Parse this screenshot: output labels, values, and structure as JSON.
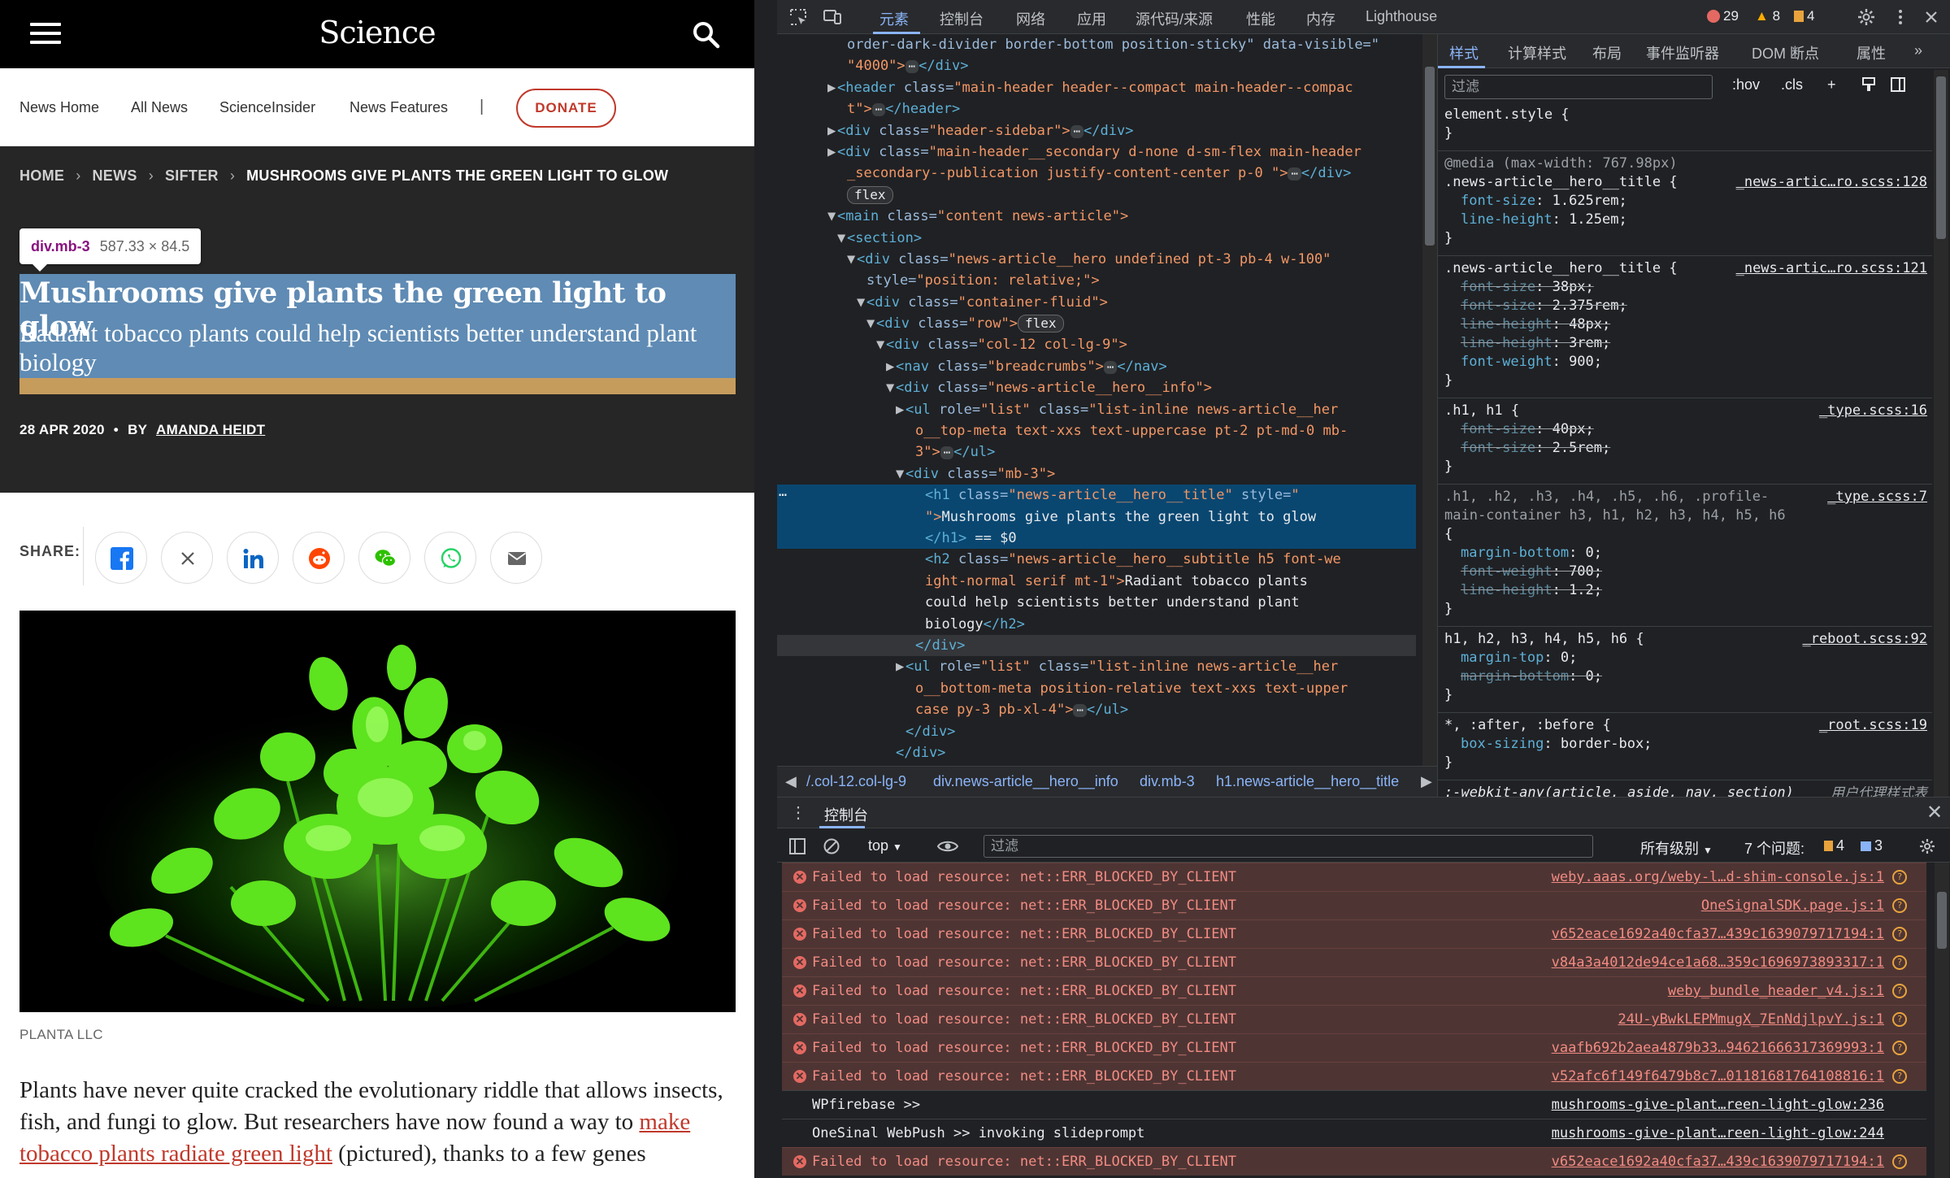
{
  "site": {
    "logo": "Science",
    "subnav": [
      "News Home",
      "All News",
      "ScienceInsider",
      "News Features"
    ],
    "subnav_sep": "|",
    "donate": "DONATE",
    "breadcrumb": [
      "HOME",
      "NEWS",
      "SIFTER",
      "MUSHROOMS GIVE PLANTS THE GREEN LIGHT TO GLOW"
    ],
    "tooltip": {
      "tag": "div.mb-3",
      "dims": "587.33 × 84.5"
    },
    "title": "Mushrooms give plants the green light to glow",
    "subtitle": "Radiant tobacco plants could help scientists better understand plant biology",
    "date": "28 APR 2020",
    "dot": "•",
    "by": "BY",
    "author": "AMANDA HEIDT",
    "share_label": "SHARE:",
    "share_icons": [
      "facebook-icon",
      "x-icon",
      "linkedin-icon",
      "reddit-icon",
      "wechat-icon",
      "whatsapp-icon",
      "email-icon"
    ],
    "photo_credit": "PLANTA LLC",
    "body_pre": "Plants have never quite cracked the evolutionary riddle that allows insects, fish, and fungi to glow. But researchers have now found a way to ",
    "body_link": "make tobacco plants radiate green light",
    "body_post": " (pictured), thanks to a few genes",
    "colors": {
      "accent": "#c0392b",
      "hero_bg": "#262626",
      "highlight": "#6fa8dc",
      "margin_hl": "#c69c5d"
    }
  },
  "devtools": {
    "tabs": [
      "元素",
      "控制台",
      "网络",
      "应用",
      "源代码/来源",
      "性能",
      "内存",
      "Lighthouse"
    ],
    "active_tab": "元素",
    "counts": {
      "errors": "29",
      "warnings": "8",
      "issues": "4"
    },
    "dom": [
      {
        "tri": "",
        "t": [
          [
            "at",
            "order-dark-divider border-bottom position-sticky\" data-visible=\""
          ]
        ],
        "indent": 6
      },
      {
        "tri": "",
        "t": [
          [
            "av",
            "\"4000\">"
          ],
          [
            "ell",
            "⋯"
          ],
          [
            "tag",
            "</div>"
          ]
        ],
        "indent": 6
      },
      {
        "tri": "▶",
        "t": [
          [
            "tag",
            "<header "
          ],
          [
            "at",
            "class="
          ],
          [
            "av",
            "\"main-header header--compact main-header--compac"
          ]
        ],
        "indent": 5
      },
      {
        "tri": "",
        "t": [
          [
            "av",
            "t\">"
          ],
          [
            "ell",
            "⋯"
          ],
          [
            "tag",
            "</header>"
          ]
        ],
        "indent": 6
      },
      {
        "tri": "▶",
        "t": [
          [
            "tag",
            "<div "
          ],
          [
            "at",
            "class="
          ],
          [
            "av",
            "\"header-sidebar\">"
          ],
          [
            "ell",
            "⋯"
          ],
          [
            "tag",
            "</div>"
          ]
        ],
        "indent": 5
      },
      {
        "tri": "▶",
        "t": [
          [
            "tag",
            "<div "
          ],
          [
            "at",
            "class="
          ],
          [
            "av",
            "\"main-header__secondary d-none d-sm-flex main-header"
          ]
        ],
        "indent": 5
      },
      {
        "tri": "",
        "t": [
          [
            "av",
            "_secondary--publication justify-content-center p-0 \">"
          ],
          [
            "ell",
            "⋯"
          ],
          [
            "tag",
            "</div>"
          ]
        ],
        "indent": 6
      },
      {
        "tri": "",
        "t": [
          [
            "pill",
            "flex"
          ]
        ],
        "indent": 6
      },
      {
        "tri": "▼",
        "t": [
          [
            "tag",
            "<main "
          ],
          [
            "at",
            "class="
          ],
          [
            "av",
            "\"content news-article\">"
          ]
        ],
        "indent": 5
      },
      {
        "tri": "▼",
        "t": [
          [
            "tag",
            "<section>"
          ]
        ],
        "indent": 6
      },
      {
        "tri": "▼",
        "t": [
          [
            "tag",
            "<div "
          ],
          [
            "at",
            "class="
          ],
          [
            "av",
            "\"news-article__hero undefined pt-3 pb-4 w-100\""
          ]
        ],
        "indent": 7
      },
      {
        "tri": "",
        "t": [
          [
            "at",
            "style="
          ],
          [
            "av",
            "\"position: relative;\">"
          ]
        ],
        "indent": 8
      },
      {
        "tri": "▼",
        "t": [
          [
            "tag",
            "<div "
          ],
          [
            "at",
            "class="
          ],
          [
            "av",
            "\"container-fluid\">"
          ]
        ],
        "indent": 8
      },
      {
        "tri": "▼",
        "t": [
          [
            "tag",
            "<div "
          ],
          [
            "at",
            "class="
          ],
          [
            "av",
            "\"row\">"
          ],
          [
            "pill",
            "flex"
          ]
        ],
        "indent": 9
      },
      {
        "tri": "▼",
        "t": [
          [
            "tag",
            "<div "
          ],
          [
            "at",
            "class="
          ],
          [
            "av",
            "\"col-12 col-lg-9\">"
          ]
        ],
        "indent": 10
      },
      {
        "tri": "▶",
        "t": [
          [
            "tag",
            "<nav "
          ],
          [
            "at",
            "class="
          ],
          [
            "av",
            "\"breadcrumbs\">"
          ],
          [
            "ell",
            "⋯"
          ],
          [
            "tag",
            "</nav>"
          ]
        ],
        "indent": 11
      },
      {
        "tri": "▼",
        "t": [
          [
            "tag",
            "<div "
          ],
          [
            "at",
            "class="
          ],
          [
            "av",
            "\"news-article__hero__info\">"
          ]
        ],
        "indent": 11
      },
      {
        "tri": "▶",
        "t": [
          [
            "tag",
            "<ul "
          ],
          [
            "at",
            "role="
          ],
          [
            "av",
            "\"list\" "
          ],
          [
            "at",
            "class="
          ],
          [
            "av",
            "\"list-inline news-article__her"
          ]
        ],
        "indent": 12
      },
      {
        "tri": "",
        "t": [
          [
            "av",
            "o__top-meta text-xxs text-uppercase pt-2 pt-md-0 mb-"
          ]
        ],
        "indent": 13
      },
      {
        "tri": "",
        "t": [
          [
            "av",
            "3\">"
          ],
          [
            "ell",
            "⋯"
          ],
          [
            "tag",
            "</ul>"
          ]
        ],
        "indent": 13
      },
      {
        "tri": "▼",
        "t": [
          [
            "tag",
            "<div "
          ],
          [
            "at",
            "class="
          ],
          [
            "av",
            "\"mb-3\">"
          ]
        ],
        "indent": 12
      },
      {
        "tri": "",
        "t": [
          [
            "tag",
            "<h1 "
          ],
          [
            "at",
            "class="
          ],
          [
            "av",
            "\"news-article__hero__title\" "
          ],
          [
            "at",
            "style="
          ],
          [
            "av",
            "\""
          ]
        ],
        "indent": 14,
        "sel": true
      },
      {
        "tri": "",
        "t": [
          [
            "av",
            "\">"
          ],
          [
            "tx",
            "Mushrooms give plants the green light to glow"
          ]
        ],
        "indent": 14,
        "sel": true
      },
      {
        "tri": "",
        "t": [
          [
            "tag",
            "</h1>"
          ],
          [
            "tx",
            " == "
          ],
          [
            "dim",
            "$0"
          ]
        ],
        "indent": 14,
        "sel": true
      },
      {
        "tri": "",
        "t": [
          [
            "tag",
            "<h2 "
          ],
          [
            "at",
            "class="
          ],
          [
            "av",
            "\"news-article__hero__subtitle h5 font-we"
          ]
        ],
        "indent": 14
      },
      {
        "tri": "",
        "t": [
          [
            "av",
            "ight-normal serif mt-1\">"
          ],
          [
            "tx",
            "Radiant tobacco plants"
          ]
        ],
        "indent": 14
      },
      {
        "tri": "",
        "t": [
          [
            "tx",
            "could help scientists better understand plant"
          ]
        ],
        "indent": 14
      },
      {
        "tri": "",
        "t": [
          [
            "tx",
            "biology"
          ],
          [
            "tag",
            "</h2>"
          ]
        ],
        "indent": 14
      },
      {
        "tri": "",
        "t": [
          [
            "tag",
            "</div>"
          ]
        ],
        "indent": 13,
        "hov": true
      },
      {
        "tri": "▶",
        "t": [
          [
            "tag",
            "<ul "
          ],
          [
            "at",
            "role="
          ],
          [
            "av",
            "\"list\" "
          ],
          [
            "at",
            "class="
          ],
          [
            "av",
            "\"list-inline news-article__her"
          ]
        ],
        "indent": 12
      },
      {
        "tri": "",
        "t": [
          [
            "av",
            "o__bottom-meta position-relative text-xxs text-upper"
          ]
        ],
        "indent": 13
      },
      {
        "tri": "",
        "t": [
          [
            "av",
            "case py-3 pb-xl-4\">"
          ],
          [
            "ell",
            "⋯"
          ],
          [
            "tag",
            "</ul>"
          ]
        ],
        "indent": 13
      },
      {
        "tri": "",
        "t": [
          [
            "tag",
            "</div>"
          ]
        ],
        "indent": 12
      },
      {
        "tri": "",
        "t": [
          [
            "tag",
            "</div>"
          ]
        ],
        "indent": 11
      }
    ],
    "crumbs": [
      "/.col-12.col-lg-9",
      "div.news-article__hero__info",
      "div.mb-3",
      "h1.news-article__hero__title"
    ],
    "style_tabs": [
      "样式",
      "计算样式",
      "布局",
      "事件监听器",
      "DOM 断点",
      "属性"
    ],
    "filter_placeholder": "过滤",
    "style_tools": [
      ":hov",
      ".cls"
    ],
    "console_tab": "控制台",
    "console_filter": "过滤",
    "console_context": "top",
    "console_levels": "所有级别",
    "console_issues_label": "7 个问题:",
    "console_issue_counts": {
      "warnings": "4",
      "info": "3"
    },
    "messages": [
      {
        "type": "err",
        "text": "Failed to load resource: net::ERR_BLOCKED_BY_CLIENT",
        "src": "weby.aaas.org/weby-l…d-shim-console.js:1"
      },
      {
        "type": "err",
        "text": "Failed to load resource: net::ERR_BLOCKED_BY_CLIENT",
        "src": "OneSignalSDK.page.js:1"
      },
      {
        "type": "err",
        "text": "Failed to load resource: net::ERR_BLOCKED_BY_CLIENT",
        "src": "v652eace1692a40cfa37…439c1639079717194:1"
      },
      {
        "type": "err",
        "text": "Failed to load resource: net::ERR_BLOCKED_BY_CLIENT",
        "src": "v84a3a4012de94ce1a68…359c1696973893317:1"
      },
      {
        "type": "err",
        "text": "Failed to load resource: net::ERR_BLOCKED_BY_CLIENT",
        "src": "weby_bundle_header_v4.js:1"
      },
      {
        "type": "err",
        "text": "Failed to load resource: net::ERR_BLOCKED_BY_CLIENT",
        "src": "24U-yBwkLEPMmugX_7EnNdjlpvY.js:1"
      },
      {
        "type": "err",
        "text": "Failed to load resource: net::ERR_BLOCKED_BY_CLIENT",
        "src": "vaafb692b2aea4879b33…94621666317369993:1"
      },
      {
        "type": "err",
        "text": "Failed to load resource: net::ERR_BLOCKED_BY_CLIENT",
        "src": "v52afc6f149f6479b8c7…01181681764108816:1"
      },
      {
        "type": "log",
        "text": "WPfirebase >>",
        "src": "mushrooms-give-plant…reen-light-glow:236"
      },
      {
        "type": "log",
        "text": "OneSinal WebPush >> invoking slideprompt",
        "src": "mushrooms-give-plant…reen-light-glow:244"
      },
      {
        "type": "err",
        "text": "Failed to load resource: net::ERR_BLOCKED_BY_CLIENT",
        "src": "v652eace1692a40cfa37…439c1639079717194:1"
      }
    ]
  }
}
